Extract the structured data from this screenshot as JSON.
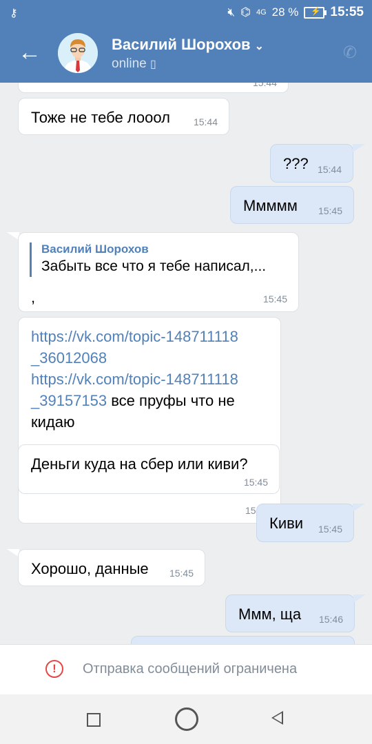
{
  "statusbar": {
    "left_icon": "key-icon",
    "icons": [
      "mute-icon",
      "wifi-hotspot-icon",
      "4g-signal-icon"
    ],
    "network": "4G",
    "battery_percent": "28 %",
    "time": "15:55"
  },
  "header": {
    "contact_name": "Василий Шорохов",
    "status": "online",
    "back_icon": "arrow-left-icon",
    "call_icon": "phone-icon"
  },
  "messages": [
    {
      "side": "in",
      "time": "15:44"
    },
    {
      "side": "in",
      "text": "Тоже не тебе лооол",
      "time": "15:44"
    },
    {
      "side": "out",
      "text": "???",
      "time": "15:44"
    },
    {
      "side": "out",
      "text": "Ммммм",
      "time": "15:45"
    },
    {
      "side": "in",
      "reply_author": "Василий Шорохов",
      "reply_text": "Забыть все что я тебе написал,...",
      "text": ",",
      "time": "15:45"
    },
    {
      "side": "in",
      "link1a": "https://vk.com/topic-148711118",
      "link1b": "_36012068",
      "link2a": "https://vk.com/topic-148711118",
      "link2b": "_39157153",
      "text_inline": " все пруфы что не",
      "text_line2": "кидаю",
      "time": "15:45"
    },
    {
      "side": "in",
      "text": "Деньги куда на сбер или киви?",
      "time": "15:45"
    },
    {
      "side": "out",
      "text": "Киви",
      "time": "15:45"
    },
    {
      "side": "in",
      "text": "Хорошо, данные",
      "time": "15:45"
    },
    {
      "side": "out",
      "text": "Ммм, ща",
      "time": "15:46"
    }
  ],
  "restricted": {
    "icon": "warning-circle-icon",
    "text": "Отправка сообщений ограничена",
    "accent": "#e64646"
  },
  "colors": {
    "header": "#5181b8",
    "incoming": "#ffffff",
    "outgoing": "#dce8f8",
    "background": "#edeef0"
  },
  "navbar": {
    "buttons": [
      "recent-apps-icon",
      "home-icon",
      "back-triangle-icon"
    ]
  }
}
